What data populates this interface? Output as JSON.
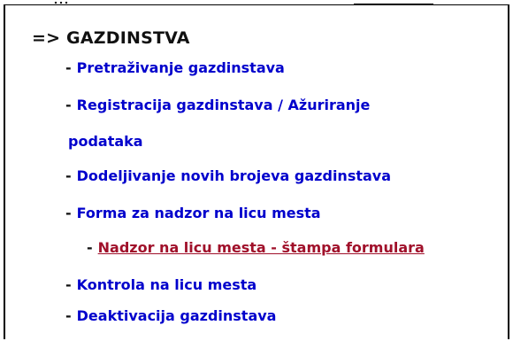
{
  "top_clip": {
    "text": "…"
  },
  "header": {
    "title": "=> GAZDINSTVA"
  },
  "menu": {
    "dash": "-",
    "items": [
      {
        "label": "Pretraživanje gazdinstava"
      },
      {
        "label": "Registracija gazdinstava / Ažuriranje"
      },
      {
        "label": "podataka"
      },
      {
        "label": "Dodeljivanje novih brojeva gazdinstava"
      },
      {
        "label": "Forma za nadzor na licu mesta"
      },
      {
        "label": "Nadzor na licu mesta - štampa formulara",
        "active": true
      },
      {
        "label": "Kontrola na licu mesta"
      },
      {
        "label": "Deaktivacija gazdinstava"
      }
    ]
  },
  "colors": {
    "link": "#0000cc",
    "active_link": "#a0102a",
    "text": "#111111",
    "border": "#000000",
    "background": "#ffffff"
  }
}
